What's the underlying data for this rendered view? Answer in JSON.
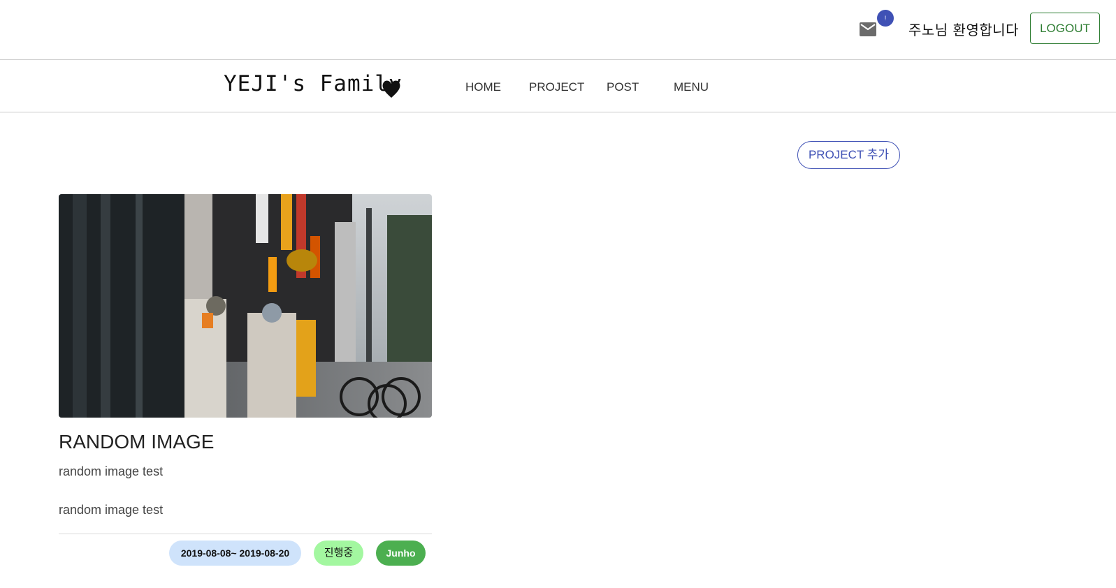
{
  "header": {
    "mail_icon": "mail-icon",
    "notification_count": "!",
    "welcome_text": "주노님 환영합니다",
    "logout_label": "LOGOUT"
  },
  "nav": {
    "brand": "YEJI's Family",
    "brand_icon": "heart-icon",
    "links": [
      "HOME",
      "PROJECT",
      "POST",
      "MENU"
    ]
  },
  "actions": {
    "add_project_label": "PROJECT 추가"
  },
  "project_card": {
    "title": "RANDOM IMAGE",
    "summary": "random image test",
    "description": "random image test",
    "date_range": "2019-08-08~ 2019-08-20",
    "status": "진행중",
    "owner": "Junho"
  },
  "colors": {
    "accent": "#3f51b5",
    "logout": "#2e7d32",
    "date_chip": "#cfe3fb",
    "status_chip": "#a3f7a0",
    "owner_chip": "#4caf50"
  }
}
